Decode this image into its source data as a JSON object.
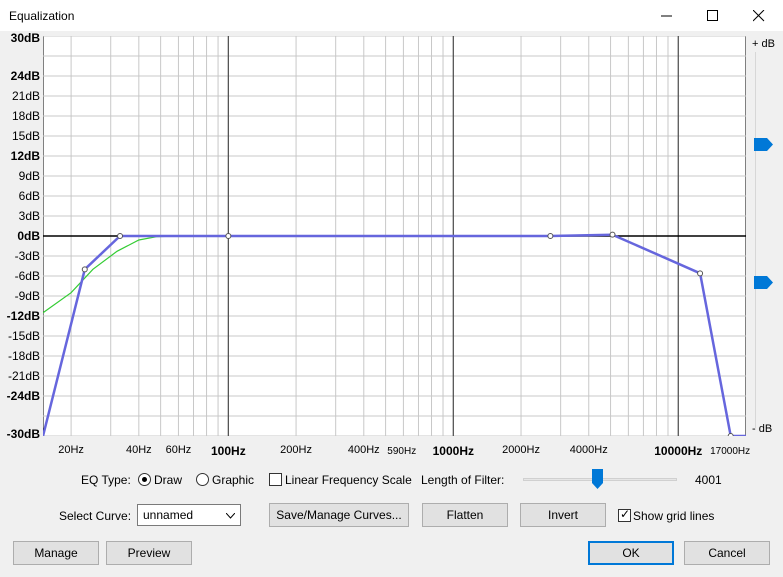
{
  "window": {
    "title": "Equalization",
    "controls": [
      "minimize-icon",
      "maximize-icon",
      "close-icon"
    ]
  },
  "graph": {
    "y_axis": {
      "unit": "dB",
      "range": [
        -30,
        30
      ],
      "labels": [
        {
          "text": "30dB",
          "value": 30,
          "bold": true
        },
        {
          "text": "24dB",
          "value": 24,
          "bold": true
        },
        {
          "text": "21dB",
          "value": 21,
          "bold": false
        },
        {
          "text": "18dB",
          "value": 18,
          "bold": false
        },
        {
          "text": "15dB",
          "value": 15,
          "bold": false
        },
        {
          "text": "12dB",
          "value": 12,
          "bold": true
        },
        {
          "text": "9dB",
          "value": 9,
          "bold": false
        },
        {
          "text": "6dB",
          "value": 6,
          "bold": false
        },
        {
          "text": "3dB",
          "value": 3,
          "bold": false
        },
        {
          "text": "0dB",
          "value": 0,
          "bold": true
        },
        {
          "text": "-3dB",
          "value": -3,
          "bold": false
        },
        {
          "text": "-6dB",
          "value": -6,
          "bold": false
        },
        {
          "text": "-9dB",
          "value": -9,
          "bold": false
        },
        {
          "text": "-12dB",
          "value": -12,
          "bold": true
        },
        {
          "text": "-15dB",
          "value": -15,
          "bold": false
        },
        {
          "text": "-18dB",
          "value": -18,
          "bold": false
        },
        {
          "text": "-21dB",
          "value": -21,
          "bold": false
        },
        {
          "text": "-24dB",
          "value": -24,
          "bold": true
        },
        {
          "text": "-30dB",
          "value": -30,
          "bold": true
        }
      ]
    },
    "x_axis": {
      "unit": "Hz",
      "scale": "log",
      "range": [
        15,
        20000
      ],
      "labels": [
        {
          "text": "20Hz",
          "value": 20,
          "style": "normal"
        },
        {
          "text": "40Hz",
          "value": 40,
          "style": "normal"
        },
        {
          "text": "60Hz",
          "value": 60,
          "style": "normal"
        },
        {
          "text": "100Hz",
          "value": 100,
          "style": "bold"
        },
        {
          "text": "200Hz",
          "value": 200,
          "style": "normal"
        },
        {
          "text": "400Hz",
          "value": 400,
          "style": "normal"
        },
        {
          "text": "590Hz",
          "value": 590,
          "style": "small"
        },
        {
          "text": "1000Hz",
          "value": 1000,
          "style": "bold"
        },
        {
          "text": "2000Hz",
          "value": 2000,
          "style": "normal"
        },
        {
          "text": "4000Hz",
          "value": 4000,
          "style": "normal"
        },
        {
          "text": "10000Hz",
          "value": 10000,
          "style": "bold"
        },
        {
          "text": "17000Hz",
          "value": 17000,
          "style": "small"
        }
      ]
    },
    "grid": true,
    "curve_points": [
      {
        "freq": 15,
        "db": -30
      },
      {
        "freq": 23,
        "db": -5
      },
      {
        "freq": 33,
        "db": 0
      },
      {
        "freq": 100,
        "db": 0
      },
      {
        "freq": 2700,
        "db": 0
      },
      {
        "freq": 5100,
        "db": 0.2
      },
      {
        "freq": 12500,
        "db": -5.6
      },
      {
        "freq": 17100,
        "db": -30
      },
      {
        "freq": 20000,
        "db": -30
      }
    ],
    "response_points": [
      {
        "freq": 15,
        "db": -11.5
      },
      {
        "freq": 20,
        "db": -8.5
      },
      {
        "freq": 25,
        "db": -5
      },
      {
        "freq": 32,
        "db": -2.3
      },
      {
        "freq": 40,
        "db": -0.6
      },
      {
        "freq": 48,
        "db": -0.1
      },
      {
        "freq": 60,
        "db": 0
      },
      {
        "freq": 2700,
        "db": 0
      },
      {
        "freq": 5100,
        "db": 0.2
      },
      {
        "freq": 12500,
        "db": -5.6
      },
      {
        "freq": 17100,
        "db": -30
      },
      {
        "freq": 20000,
        "db": -30
      }
    ],
    "colors": {
      "curve": "#6666dd",
      "response": "#33cc33",
      "grid": "#c8c8c8",
      "zero_line": "#000000",
      "accent": "#0078d7"
    },
    "gain_slider": {
      "plus_label": "+ dB",
      "minus_label": "- dB"
    }
  },
  "controls": {
    "eq_type_label": "EQ Type:",
    "draw_label": "Draw",
    "graphic_label": "Graphic",
    "eq_type_selected": "Draw",
    "linear_freq_label": "Linear Frequency Scale",
    "linear_freq_checked": false,
    "length_label": "Length of Filter:",
    "length_value": "4001",
    "length_fraction": 0.48,
    "select_curve_label": "Select Curve:",
    "select_curve_value": "unnamed",
    "save_manage_label": "Save/Manage Curves...",
    "flatten_label": "Flatten",
    "invert_label": "Invert",
    "grid_lines_label": "Show grid lines",
    "grid_lines_checked": true
  },
  "footer": {
    "manage_label": "Manage",
    "preview_label": "Preview",
    "ok_label": "OK",
    "cancel_label": "Cancel"
  }
}
